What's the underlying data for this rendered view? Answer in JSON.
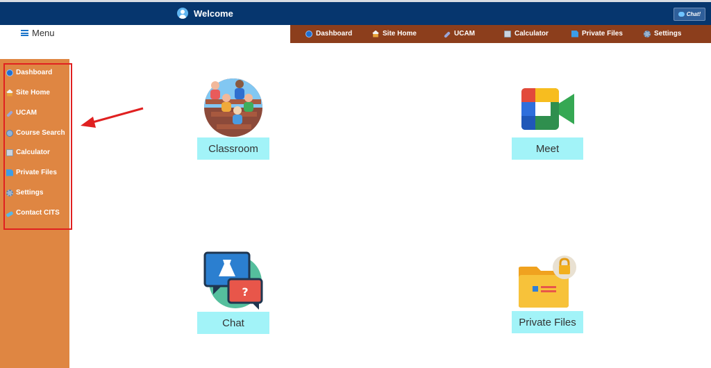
{
  "header": {
    "welcome_text": "Welcome",
    "chat_button_label": "Chat!"
  },
  "menu_toggle": {
    "label": "Menu"
  },
  "topnav": {
    "items": [
      {
        "label": "Dashboard",
        "icon": "globe-icon"
      },
      {
        "label": "Site Home",
        "icon": "home-icon"
      },
      {
        "label": "UCAM",
        "icon": "link-icon"
      },
      {
        "label": "Calculator",
        "icon": "calculator-icon"
      },
      {
        "label": "Private Files",
        "icon": "file-icon"
      },
      {
        "label": "Settings",
        "icon": "gear-icon"
      }
    ]
  },
  "sidebar": {
    "items": [
      {
        "label": "Dashboard",
        "icon": "globe-icon"
      },
      {
        "label": "Site Home",
        "icon": "home-icon"
      },
      {
        "label": "UCAM",
        "icon": "link-icon"
      },
      {
        "label": "Course Search",
        "icon": "search-icon"
      },
      {
        "label": "Calculator",
        "icon": "calculator-icon"
      },
      {
        "label": "Private Files",
        "icon": "file-icon"
      },
      {
        "label": "Settings",
        "icon": "gear-icon"
      },
      {
        "label": "Contact CITS",
        "icon": "phone-icon"
      }
    ]
  },
  "tiles": [
    {
      "label": "Classroom",
      "icon": "classroom-icon"
    },
    {
      "label": "Meet",
      "icon": "meet-icon"
    },
    {
      "label": "Chat",
      "icon": "chat-icon"
    },
    {
      "label": "Private Files",
      "icon": "lock-folder-icon"
    }
  ],
  "colors": {
    "header_bg": "#06366e",
    "topnav_bg": "#8c3e1c",
    "sidebar_bg": "#df8642",
    "tile_label_bg": "#a2f3f8",
    "annotation_red": "#e02020"
  }
}
